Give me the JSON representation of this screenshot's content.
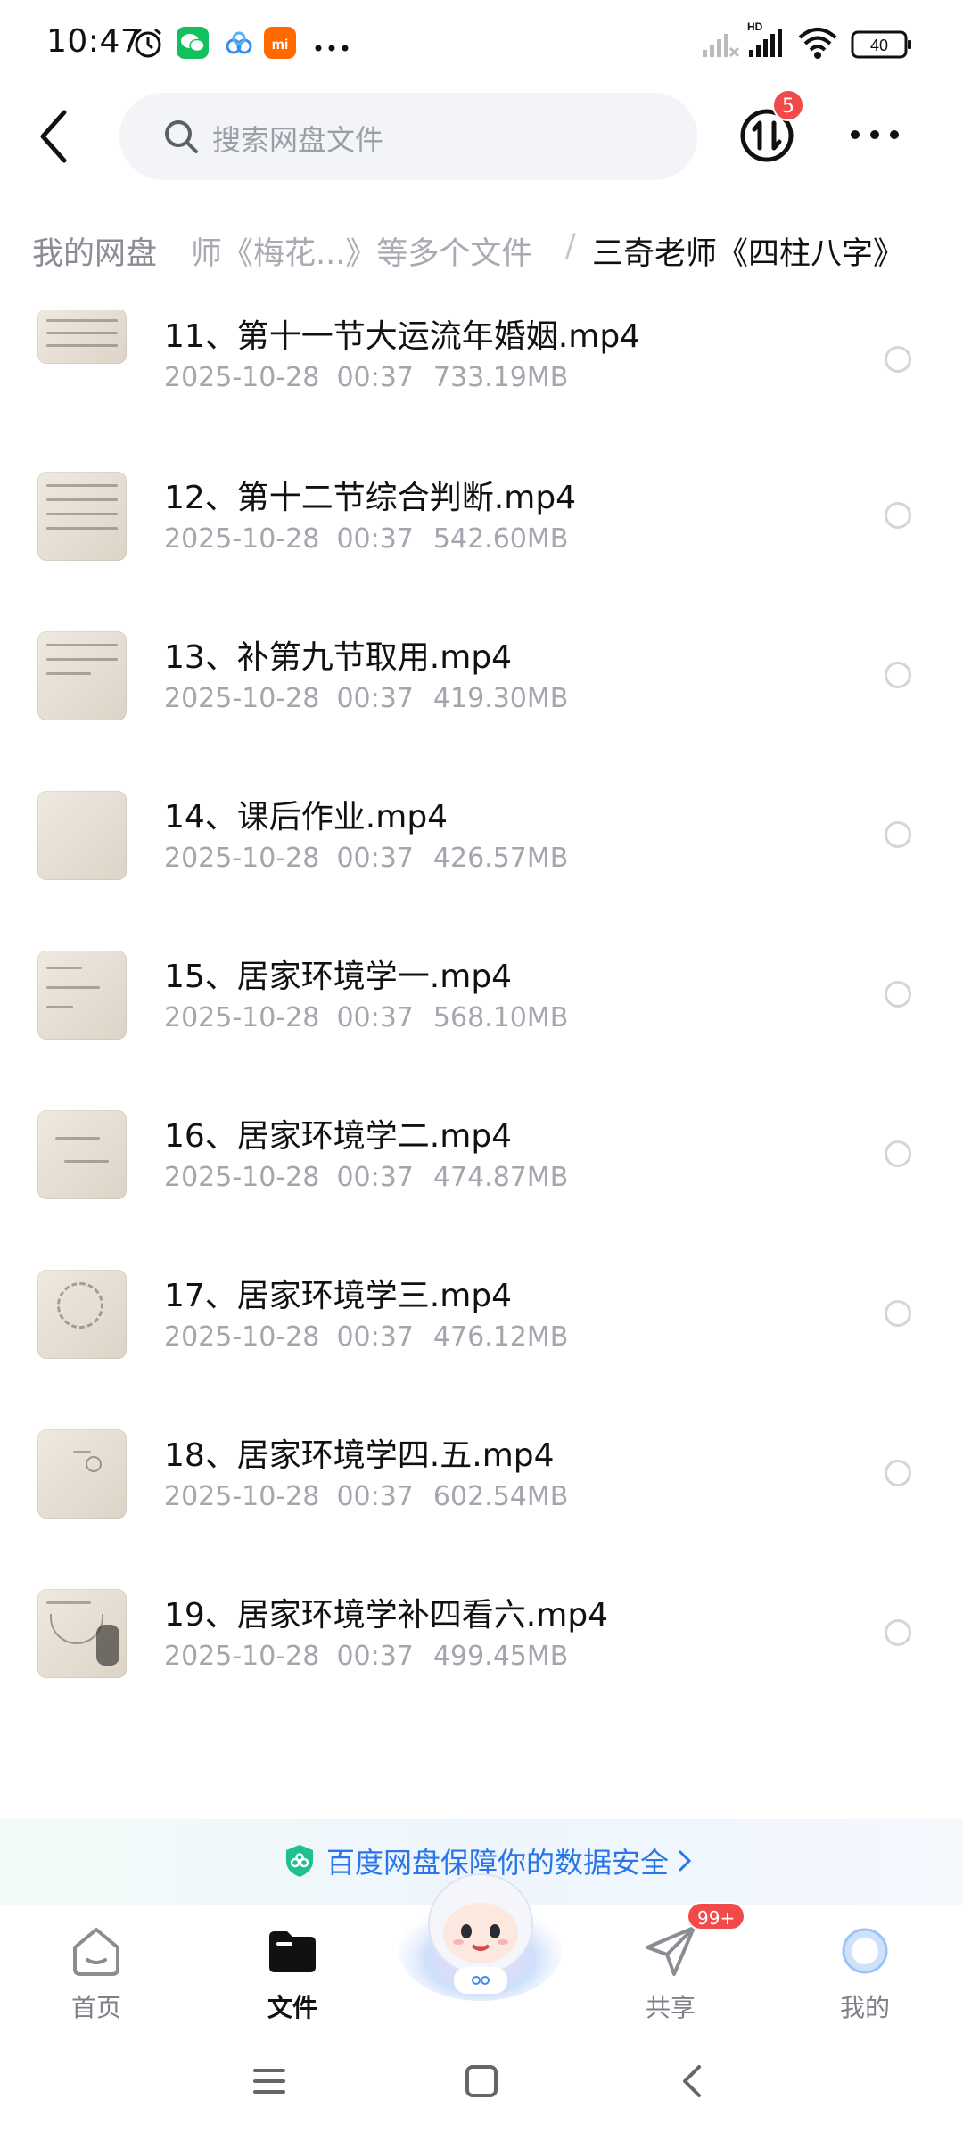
{
  "status_bar": {
    "time": "10:47",
    "battery": "40",
    "network_label": "HD"
  },
  "search": {
    "placeholder": "搜索网盘文件"
  },
  "transfer": {
    "badge": "5"
  },
  "breadcrumb": {
    "root": "我的网盘",
    "middle": "师《梅花...》等多个文件",
    "separator": "/",
    "current": "三奇老师《四柱八字》"
  },
  "files": [
    {
      "name": "11、第十一节大运流年婚姻.mp4",
      "date": "2025-10-28",
      "time": "00:37",
      "size": "733.19MB"
    },
    {
      "name": "12、第十二节综合判断.mp4",
      "date": "2025-10-28",
      "time": "00:37",
      "size": "542.60MB"
    },
    {
      "name": "13、补第九节取用.mp4",
      "date": "2025-10-28",
      "time": "00:37",
      "size": "419.30MB"
    },
    {
      "name": "14、课后作业.mp4",
      "date": "2025-10-28",
      "time": "00:37",
      "size": "426.57MB"
    },
    {
      "name": "15、居家环境学一.mp4",
      "date": "2025-10-28",
      "time": "00:37",
      "size": "568.10MB"
    },
    {
      "name": "16、居家环境学二.mp4",
      "date": "2025-10-28",
      "time": "00:37",
      "size": "474.87MB"
    },
    {
      "name": "17、居家环境学三.mp4",
      "date": "2025-10-28",
      "time": "00:37",
      "size": "476.12MB"
    },
    {
      "name": "18、居家环境学四.五.mp4",
      "date": "2025-10-28",
      "time": "00:37",
      "size": "602.54MB"
    },
    {
      "name": "19、居家环境学补四看六.mp4",
      "date": "2025-10-28",
      "time": "00:37",
      "size": "499.45MB"
    }
  ],
  "security_banner": {
    "text": "百度网盘保障你的数据安全"
  },
  "bottom_nav": {
    "home": "首页",
    "files": "文件",
    "share": "共享",
    "share_badge": "99+",
    "me": "我的"
  },
  "colors": {
    "accent_blue": "#2a76e8",
    "badge_red": "#f24a4a",
    "meta_gray": "#a3a6ad"
  }
}
